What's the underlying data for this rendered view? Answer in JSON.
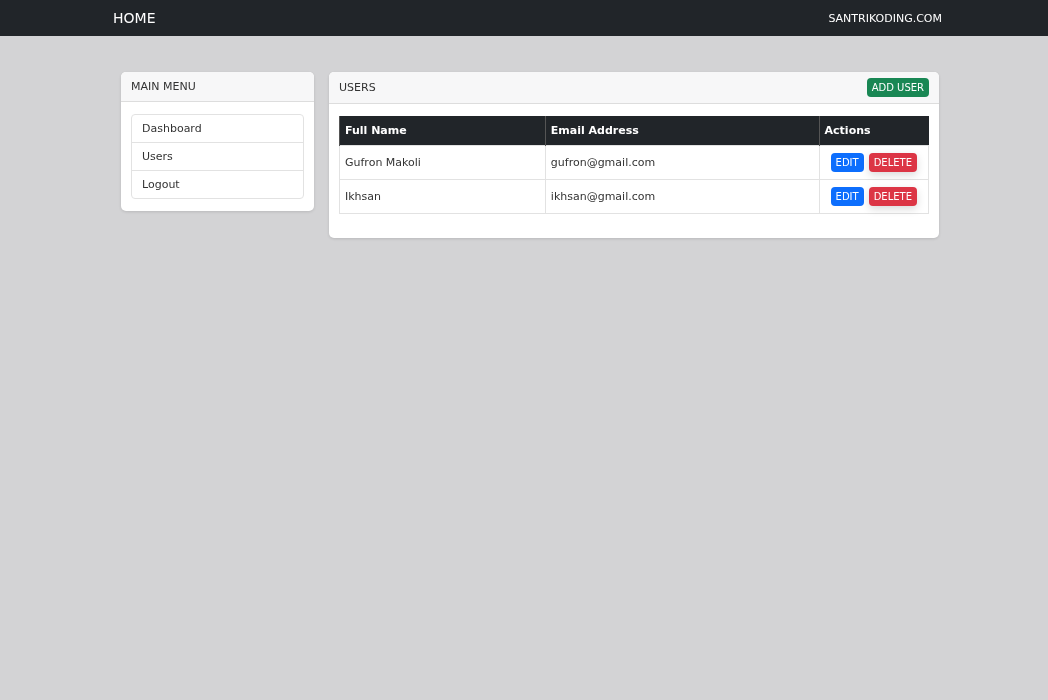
{
  "navbar": {
    "brand": "HOME",
    "link": "SANTRIKODING.COM"
  },
  "sidebar": {
    "title": "MAIN MENU",
    "items": [
      {
        "label": "Dashboard"
      },
      {
        "label": "Users"
      },
      {
        "label": "Logout"
      }
    ]
  },
  "users_card": {
    "title": "USERS",
    "add_button": "ADD USER",
    "table": {
      "columns": [
        "Full Name",
        "Email Address",
        "Actions"
      ],
      "rows": [
        {
          "name": "Gufron Makoli",
          "email": "gufron@gmail.com",
          "edit": "EDIT",
          "delete": "DELETE"
        },
        {
          "name": "Ikhsan",
          "email": "ikhsan@gmail.com",
          "edit": "EDIT",
          "delete": "DELETE"
        }
      ]
    }
  }
}
